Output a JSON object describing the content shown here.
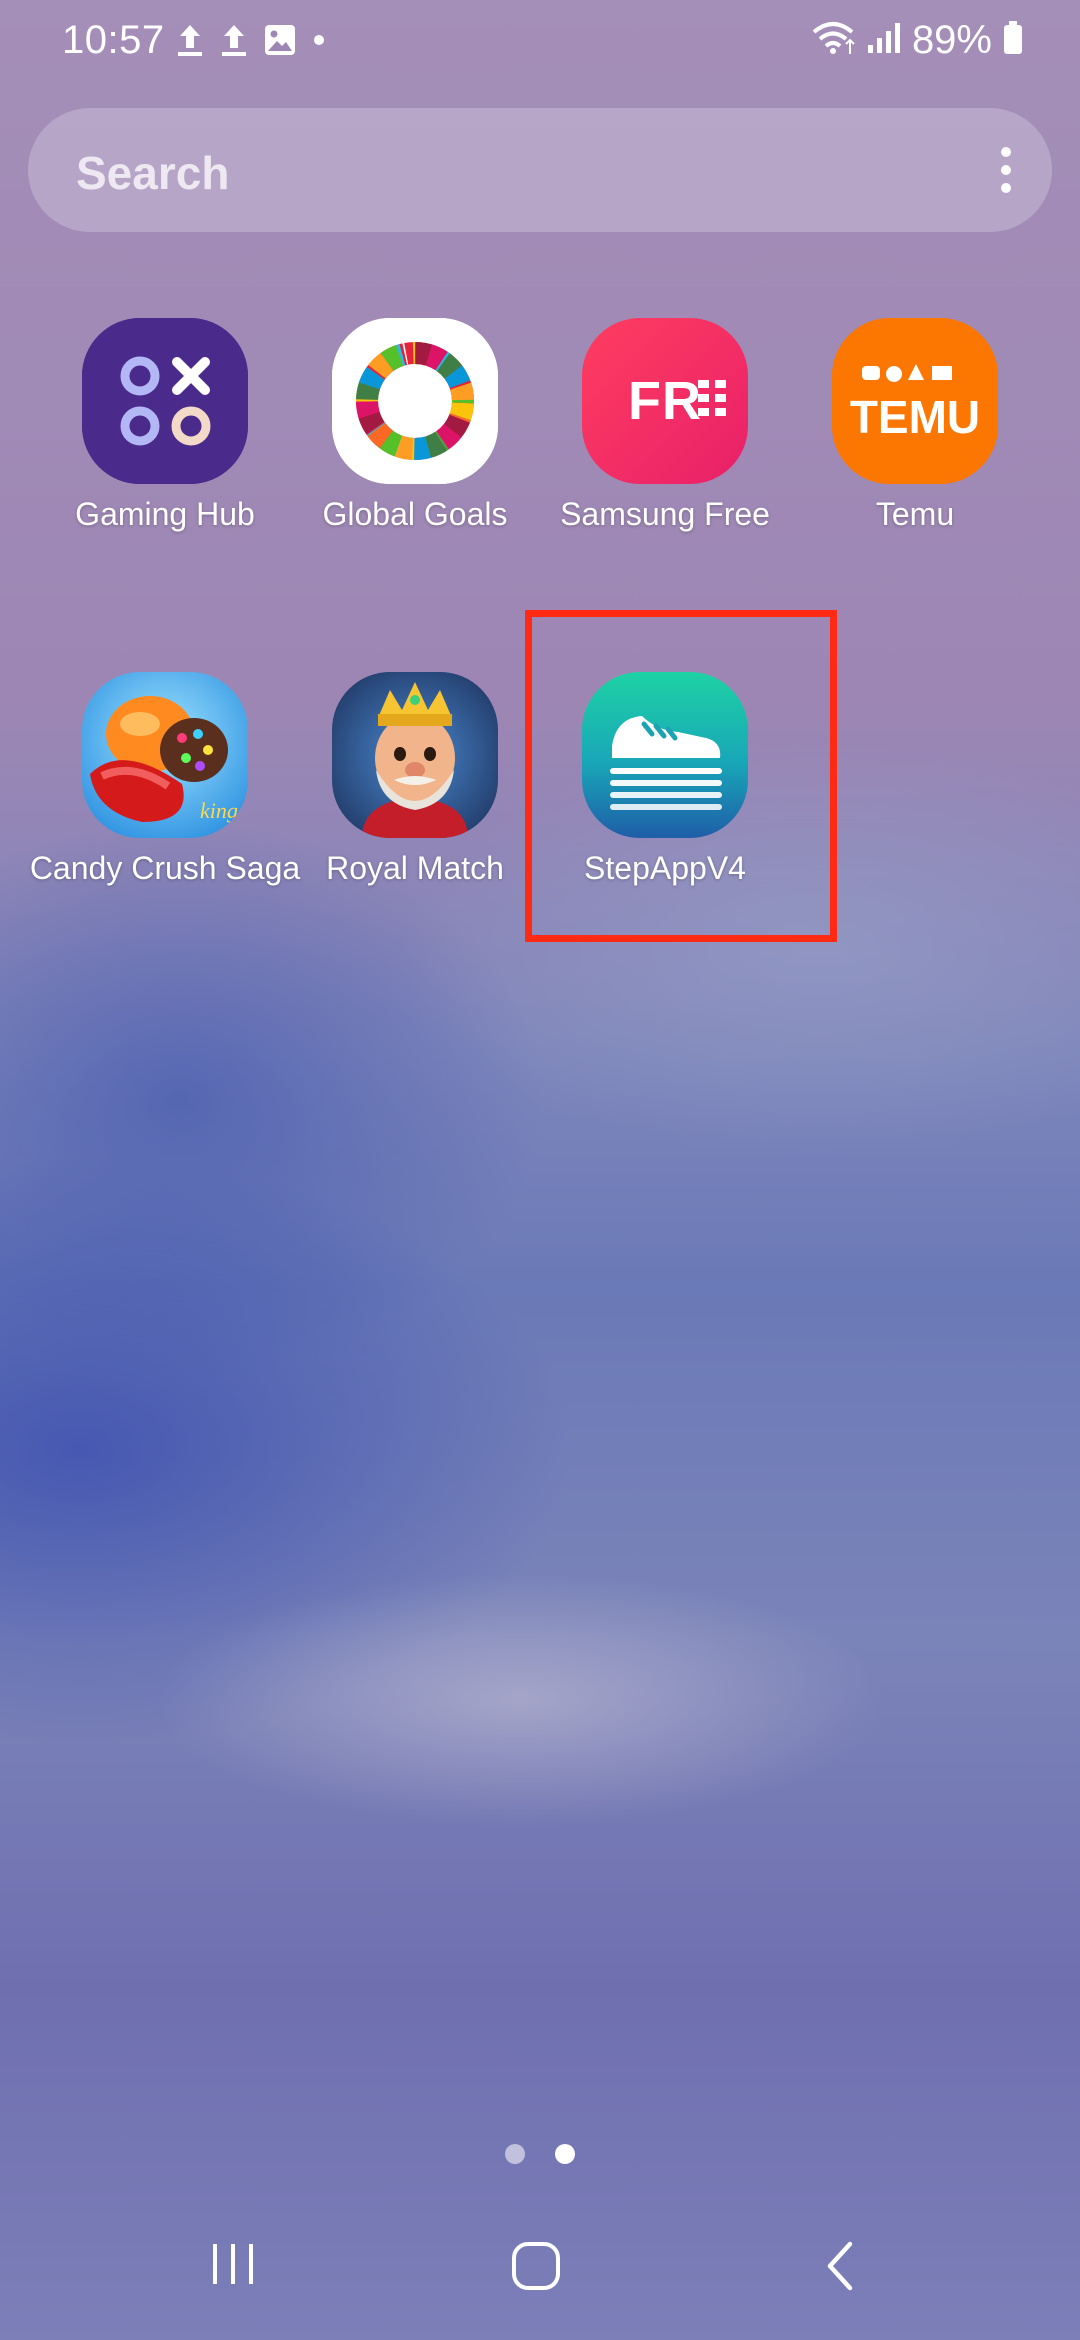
{
  "status_bar": {
    "time": "10:57",
    "battery": "89%",
    "notification_icons": [
      "upload-icon",
      "upload-icon",
      "image-icon",
      "dot-icon"
    ],
    "system_icons": [
      "wifi-icon",
      "signal-icon",
      "battery-icon"
    ]
  },
  "search": {
    "placeholder": "Search",
    "menu_icon": "more-vertical-icon"
  },
  "apps": [
    {
      "label": "Gaming Hub",
      "icon": "gaming-hub-icon",
      "color": "#4a2a8a"
    },
    {
      "label": "Global Goals",
      "icon": "global-goals-icon",
      "color": "#ffffff"
    },
    {
      "label": "Samsung Free",
      "icon": "samsung-free-icon",
      "color": "#f0305a"
    },
    {
      "label": "Temu",
      "icon": "temu-icon",
      "color": "#fb7701"
    },
    {
      "label": "Candy Crush Saga",
      "icon": "candy-crush-icon",
      "color": "#e0531a"
    },
    {
      "label": "Royal Match",
      "icon": "royal-match-icon",
      "color": "#2b4a7a"
    },
    {
      "label": "StepAppV4",
      "icon": "shoe-icon",
      "color": "#1aa7a0"
    }
  ],
  "highlight_color": "#ff2a14",
  "page_indicator": {
    "pages": 2,
    "current": 2
  },
  "nav_bar": [
    "recent-apps-icon",
    "home-icon",
    "back-icon"
  ]
}
